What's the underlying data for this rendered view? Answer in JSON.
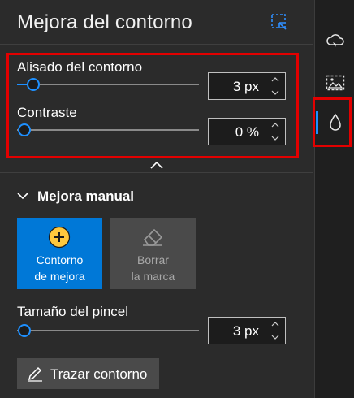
{
  "panel": {
    "title": "Mejora del contorno",
    "edge_refine": {
      "smoothing_label": "Alisado del contorno",
      "smoothing_value": "3 px",
      "smoothing_level": 0.07,
      "contrast_label": "Contraste",
      "contrast_value": "0 %",
      "contrast_level": 0.0
    },
    "manual": {
      "section_label": "Mejora manual",
      "tile_add_line1": "Contorno",
      "tile_add_line2": "de mejora",
      "tile_erase_line1": "Borrar",
      "tile_erase_line2": "la marca",
      "brush_label": "Tamaño del pincel",
      "brush_value": "3 px",
      "brush_level": 0.0,
      "trace_label": "Trazar contorno"
    }
  },
  "colors": {
    "accent": "#0078d7",
    "slider_accent": "#1e90ff",
    "highlight": "#e30000",
    "add_icon": "#ffc83d"
  },
  "rail": {
    "items": [
      "cloud-select-icon",
      "image-frame-icon",
      "droplet-icon"
    ],
    "active_item": "droplet-icon"
  }
}
